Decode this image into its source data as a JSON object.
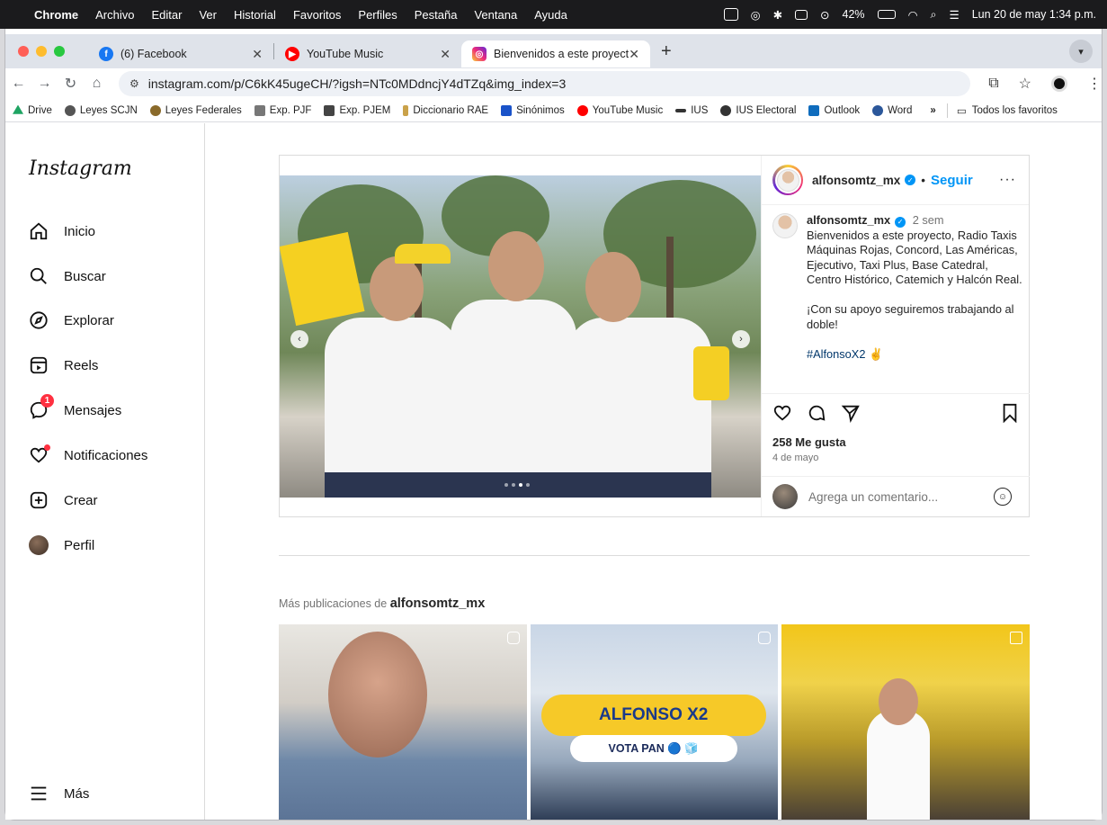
{
  "menubar": {
    "app": "Chrome",
    "items": [
      "Archivo",
      "Editar",
      "Ver",
      "Historial",
      "Favoritos",
      "Perfiles",
      "Pestaña",
      "Ventana",
      "Ayuda"
    ],
    "battery": "42%",
    "datetime": "Lun 20 de may  1:34 p.m."
  },
  "tabs": [
    {
      "label": "(6) Facebook",
      "icon": "facebook-icon",
      "color": "#1877f2"
    },
    {
      "label": "YouTube Music",
      "icon": "youtube-music-icon",
      "color": "#ff0000"
    },
    {
      "label": "Bienvenidos a este proyecto,",
      "icon": "instagram-icon",
      "color": "#e1306c"
    }
  ],
  "toolbar": {
    "url": "instagram.com/p/C6kK45ugeCH/?igsh=NTc0MDdncjY4dTZq&img_index=3"
  },
  "bookmarks": [
    {
      "label": "Drive",
      "color": "#1fa463"
    },
    {
      "label": "Leyes SCJN",
      "color": "#555555"
    },
    {
      "label": "Leyes Federales",
      "color": "#8a6a2a"
    },
    {
      "label": "Exp. PJF",
      "color": "#777777"
    },
    {
      "label": "Exp. PJEM",
      "color": "#444444"
    },
    {
      "label": "Diccionario RAE",
      "color": "#caa24a"
    },
    {
      "label": "Sinónimos",
      "color": "#1a53c9"
    },
    {
      "label": "YouTube Music",
      "color": "#ff0000"
    },
    {
      "label": "IUS",
      "color": "#333333"
    },
    {
      "label": "IUS Electoral",
      "color": "#333333"
    },
    {
      "label": "Outlook",
      "color": "#0f6cbd"
    },
    {
      "label": "Word",
      "color": "#2b579a"
    }
  ],
  "bookmarks_more": "»",
  "bookmarks_all": "Todos los favoritos",
  "sidebar": {
    "logo": "Instagram",
    "items": [
      {
        "label": "Inicio",
        "icon": "home-icon"
      },
      {
        "label": "Buscar",
        "icon": "search-icon"
      },
      {
        "label": "Explorar",
        "icon": "compass-icon"
      },
      {
        "label": "Reels",
        "icon": "reels-icon"
      },
      {
        "label": "Mensajes",
        "icon": "messenger-icon",
        "badge": "1"
      },
      {
        "label": "Notificaciones",
        "icon": "heart-icon"
      },
      {
        "label": "Crear",
        "icon": "plus-square-icon"
      },
      {
        "label": "Perfil",
        "icon": "avatar"
      }
    ],
    "more": "Más"
  },
  "post": {
    "username": "alfonsomtz_mx",
    "separator": "•",
    "follow": "Seguir",
    "time": "2 sem",
    "caption_lines": [
      "Bienvenidos a este proyecto, Radio Taxis Máquinas Rojas, Concord, Las Américas, Ejecutivo, Taxi Plus, Base Catedral, Centro Histórico, Catemich y Halcón Real.",
      "¡Con su apoyo seguiremos trabajando al doble!"
    ],
    "hashtag": "#AlfonsoX2 ✌",
    "likes": "258 Me gusta",
    "date": "4 de mayo",
    "comment_placeholder": "Agrega un comentario...",
    "carousel_index": 3,
    "carousel_total": 4
  },
  "more_posts": {
    "prefix": "Más publicaciones de",
    "user": "alfonsomtz_mx",
    "thumb2_title": "ALFONSO X2",
    "thumb2_subtitle": "VOTA PAN 🔵 🧊"
  }
}
